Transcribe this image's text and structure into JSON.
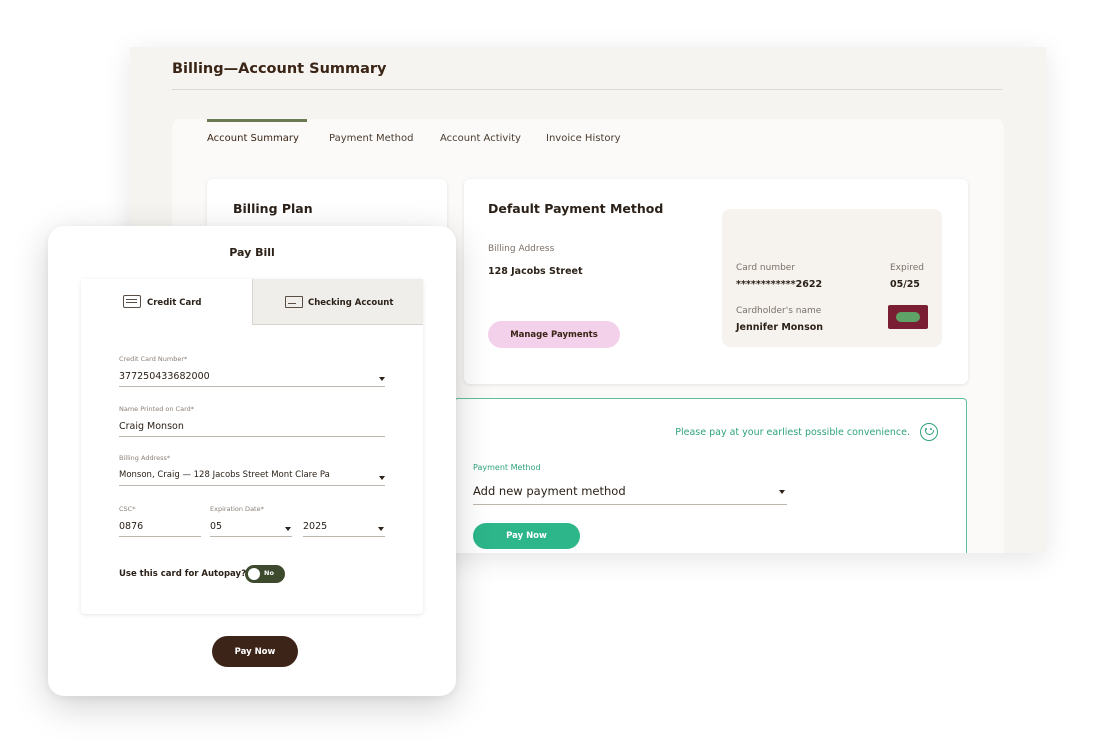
{
  "page": {
    "title": "Billing—Account Summary"
  },
  "tabs": [
    {
      "label": "Account Summary",
      "active": true
    },
    {
      "label": "Payment Method",
      "active": false
    },
    {
      "label": "Account Activity",
      "active": false
    },
    {
      "label": "Invoice History",
      "active": false
    }
  ],
  "billing_plan": {
    "title": "Billing Plan"
  },
  "default_payment": {
    "title": "Default Payment Method",
    "billing_address_label": "Billing Address",
    "billing_address": "128 Jacobs Street",
    "manage_button": "Manage Payments",
    "card": {
      "number_label": "Card number",
      "number": "************2622",
      "expired_label": "Expired",
      "expiry": "05/25",
      "holder_label": "Cardholder's name",
      "holder": "Jennifer Monson",
      "logo_icon": "card-brand-logo"
    }
  },
  "payment_panel": {
    "notice": "Please pay at your earliest possible convenience.",
    "notice_icon": "smile-icon",
    "method_label": "Payment Method",
    "method_value": "Add new payment method",
    "pay_button": "Pay Now"
  },
  "pay_bill": {
    "title": "Pay Bill",
    "tab_credit": "Credit Card",
    "tab_checking": "Checking Account",
    "card_number_label": "Credit Card Number*",
    "card_number": "377250433682000",
    "name_label": "Name Printed on Card*",
    "name": "Craig Monson",
    "billing_address_label": "Billing Address*",
    "billing_address": "Monson, Craig — 128 Jacobs Street Mont Clare Pa",
    "csc_label": "CSC*",
    "csc": "0876",
    "expiration_label": "Expiration Date*",
    "exp_month": "05",
    "exp_year": "2025",
    "autopay_label": "Use this card for Autopay?",
    "autopay_toggle": "No",
    "pay_button": "Pay Now"
  },
  "colors": {
    "brand_dark": "#3d2418",
    "accent_green": "#2db68a",
    "tab_underline": "#6b7a52",
    "pink_button": "#f3d1ea",
    "toggle_off": "#3d4a2e"
  }
}
